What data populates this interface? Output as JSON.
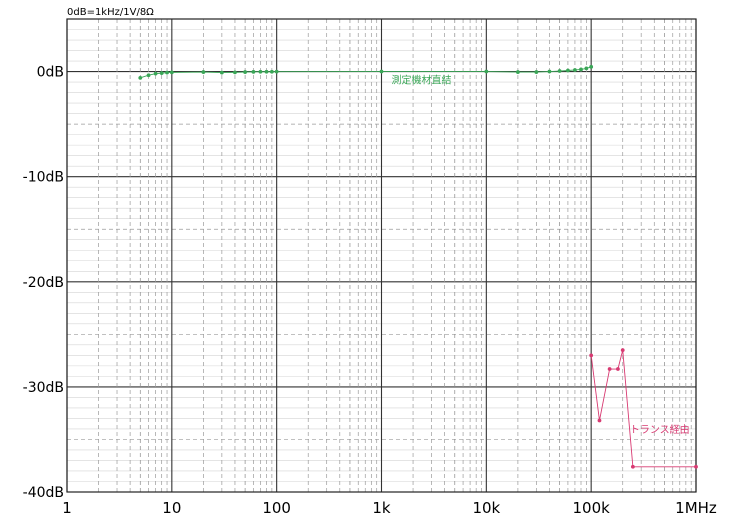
{
  "chart_data": {
    "type": "line",
    "title": "0dB=1kHz/1V/8Ω",
    "x_scale": "log",
    "xlim": [
      1,
      1000000
    ],
    "ylim": [
      -40,
      5
    ],
    "x_tick_values": [
      1,
      10,
      100,
      1000,
      10000,
      100000,
      1000000
    ],
    "x_tick_labels": [
      "1",
      "10",
      "100",
      "1k",
      "10k",
      "100k",
      "1MHz"
    ],
    "y_tick_values": [
      0,
      -10,
      -20,
      -30,
      -40
    ],
    "y_tick_labels": [
      "0dB",
      "-10dB",
      "-20dB",
      "-30dB",
      "-40dB"
    ],
    "grid": true,
    "series": [
      {
        "name": "測定機材直結",
        "color": "#3aa657",
        "x": [
          5,
          6,
          7,
          8,
          9,
          10,
          20,
          30,
          40,
          50,
          60,
          70,
          80,
          90,
          100,
          1000,
          10000,
          20000,
          30000,
          40000,
          50000,
          60000,
          70000,
          80000,
          90000,
          100000
        ],
        "y": [
          -0.6,
          -0.35,
          -0.2,
          -0.15,
          -0.1,
          -0.08,
          -0.05,
          -0.1,
          -0.08,
          -0.05,
          -0.03,
          -0.02,
          -0.02,
          -0.02,
          -0.01,
          0,
          0,
          -0.05,
          -0.05,
          0.0,
          0.05,
          0.1,
          0.15,
          0.2,
          0.3,
          0.45
        ]
      },
      {
        "name": "トランス経由",
        "color": "#d83a72",
        "x": [
          100000,
          120000,
          150000,
          180000,
          200000,
          250000,
          1000000
        ],
        "y": [
          -27,
          -33.2,
          -28.3,
          -28.3,
          -26.5,
          -37.6,
          -37.6
        ]
      }
    ]
  }
}
